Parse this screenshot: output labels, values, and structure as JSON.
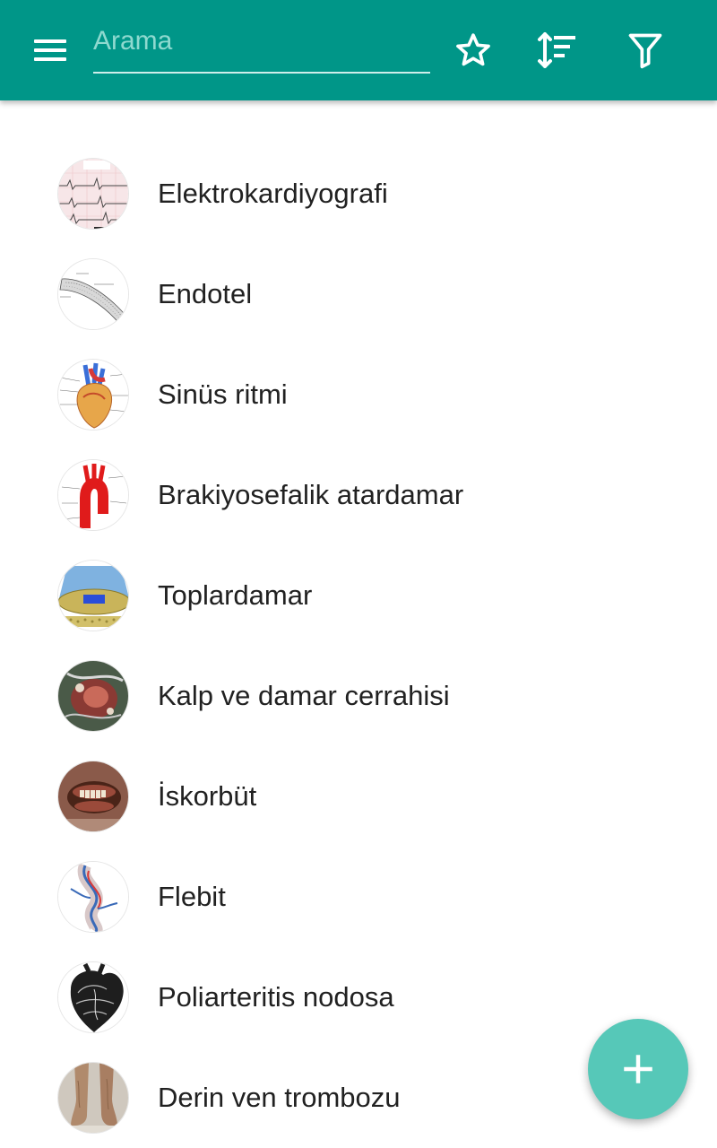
{
  "app_bar": {
    "search": {
      "placeholder": "Arama",
      "value": ""
    },
    "icons": [
      "menu-icon",
      "star-icon",
      "sort-icon",
      "filter-icon"
    ],
    "background": "#009688"
  },
  "list": {
    "items": [
      {
        "label": "Elektrokardiyografi",
        "image": "ecg-thumbnail"
      },
      {
        "label": "Endotel",
        "image": "endothelium-thumbnail"
      },
      {
        "label": "Sinüs ritmi",
        "image": "heart-diagram-thumbnail"
      },
      {
        "label": "Brakiyosefalik atardamar",
        "image": "aorta-thumbnail"
      },
      {
        "label": "Toplardamar",
        "image": "vein-thumbnail"
      },
      {
        "label": "Kalp ve damar cerrahisi",
        "image": "surgery-photo-thumbnail"
      },
      {
        "label": "İskorbüt",
        "image": "scurvy-photo-thumbnail"
      },
      {
        "label": "Flebit",
        "image": "phlebitis-thumbnail"
      },
      {
        "label": "Poliarteritis nodosa",
        "image": "heart-engraving-thumbnail"
      },
      {
        "label": "Derin ven trombozu",
        "image": "legs-photo-thumbnail"
      }
    ]
  },
  "fab": {
    "icon": "plus-icon",
    "color": "#56c8b8"
  }
}
